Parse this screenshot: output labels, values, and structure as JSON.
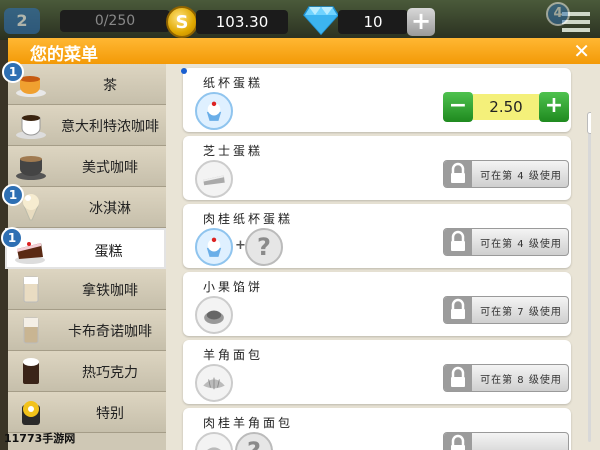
{
  "hud": {
    "level": "2",
    "xp": "0/250",
    "coin_symbol": "S",
    "coins": "103.30",
    "gems": "10",
    "plus": "+",
    "menu_badge": "4"
  },
  "panel": {
    "title": "您的菜单",
    "close": "✕"
  },
  "categories": [
    {
      "label": "茶",
      "badge": "1",
      "icon": "tea-cup-icon"
    },
    {
      "label": "意大利特浓咖啡",
      "badge": "",
      "icon": "espresso-cup-icon"
    },
    {
      "label": "美式咖啡",
      "badge": "",
      "icon": "americano-cup-icon"
    },
    {
      "label": "冰淇淋",
      "badge": "1",
      "icon": "ice-cream-icon"
    },
    {
      "label": "蛋糕",
      "badge": "1",
      "icon": "cake-icon",
      "active": true
    },
    {
      "label": "拿铁咖啡",
      "badge": "",
      "icon": "latte-glass-icon"
    },
    {
      "label": "卡布奇诺咖啡",
      "badge": "",
      "icon": "cappuccino-glass-icon"
    },
    {
      "label": "热巧克力",
      "badge": "",
      "icon": "hot-chocolate-icon"
    },
    {
      "label": "特别",
      "badge": "",
      "icon": "special-icon"
    }
  ],
  "items": [
    {
      "name": "纸杯蛋糕",
      "unlocked": true,
      "price": "2.50",
      "minus": "−",
      "plus": "+"
    },
    {
      "name": "芝士蛋糕",
      "unlocked": false,
      "lock_text": "可在第 4 级使用"
    },
    {
      "name": "肉桂纸杯蛋糕",
      "unlocked": false,
      "lock_text": "可在第 4 级使用",
      "extra": "?",
      "plus_sign": "+"
    },
    {
      "name": "小果馅饼",
      "unlocked": false,
      "lock_text": "可在第 7 级使用"
    },
    {
      "name": "羊角面包",
      "unlocked": false,
      "lock_text": "可在第 8 级使用"
    },
    {
      "name": "肉桂羊角面包",
      "unlocked": false,
      "lock_text": "",
      "extra": "?"
    }
  ],
  "watermark": "11773手游网",
  "colors": {
    "header": "#f39a07",
    "accent_green": "#2fa52f",
    "badge_blue": "#2e6fb3"
  }
}
